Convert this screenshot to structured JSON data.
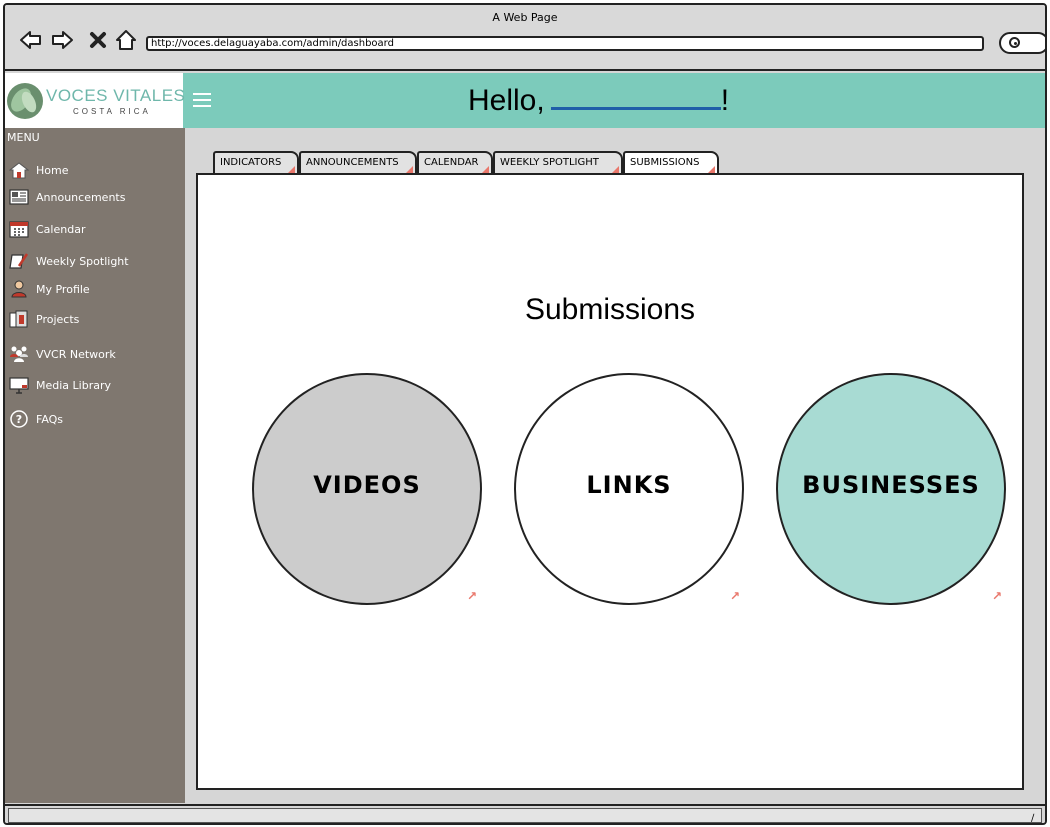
{
  "window": {
    "title": "A Web Page",
    "url": "http://voces.delaguayaba.com/admin/dashboard",
    "nav_back_icon": "back-arrow-icon",
    "nav_forward_icon": "forward-arrow-icon",
    "nav_stop_icon": "stop-icon",
    "nav_home_icon": "home-icon",
    "search_icon": "search-icon"
  },
  "header": {
    "logo_title": "VOCES VITALES",
    "logo_subtitle": "COSTA RICA",
    "greeting": "Hello,",
    "greeting_suffix": "!",
    "colors": {
      "header_bg": "#7ccbbb",
      "accent_underline": "#1f5fa8"
    }
  },
  "sidebar": {
    "menu_label": "MENU",
    "items": [
      {
        "label": "Home",
        "icon": "house-icon"
      },
      {
        "label": "Announcements",
        "icon": "newspaper-icon"
      },
      {
        "label": "Calendar",
        "icon": "calendar-icon"
      },
      {
        "label": "Weekly Spotlight",
        "icon": "notebook-pen-icon"
      },
      {
        "label": "My Profile",
        "icon": "person-icon"
      },
      {
        "label": "Projects",
        "icon": "folder-icon"
      },
      {
        "label": "VVCR Network",
        "icon": "people-network-icon"
      },
      {
        "label": "Media Library",
        "icon": "monitor-icon"
      },
      {
        "label": "FAQs",
        "icon": "question-icon"
      }
    ],
    "colors": {
      "bg": "#7f776f",
      "text": "#ffffff"
    }
  },
  "tabs": [
    {
      "label": "INDICATORS",
      "active": false
    },
    {
      "label": "ANNOUNCEMENTS",
      "active": false
    },
    {
      "label": "CALENDAR",
      "active": false
    },
    {
      "label": "WEEKLY SPOTLIGHT",
      "active": false
    },
    {
      "label": "SUBMISSIONS",
      "active": true
    }
  ],
  "main": {
    "title": "Submissions",
    "circles": [
      {
        "label": "VIDEOS",
        "color": "#cccccc"
      },
      {
        "label": "LINKS",
        "color": "#ffffff"
      },
      {
        "label": "BUSINESSES",
        "color": "#a8dbd3"
      }
    ]
  }
}
